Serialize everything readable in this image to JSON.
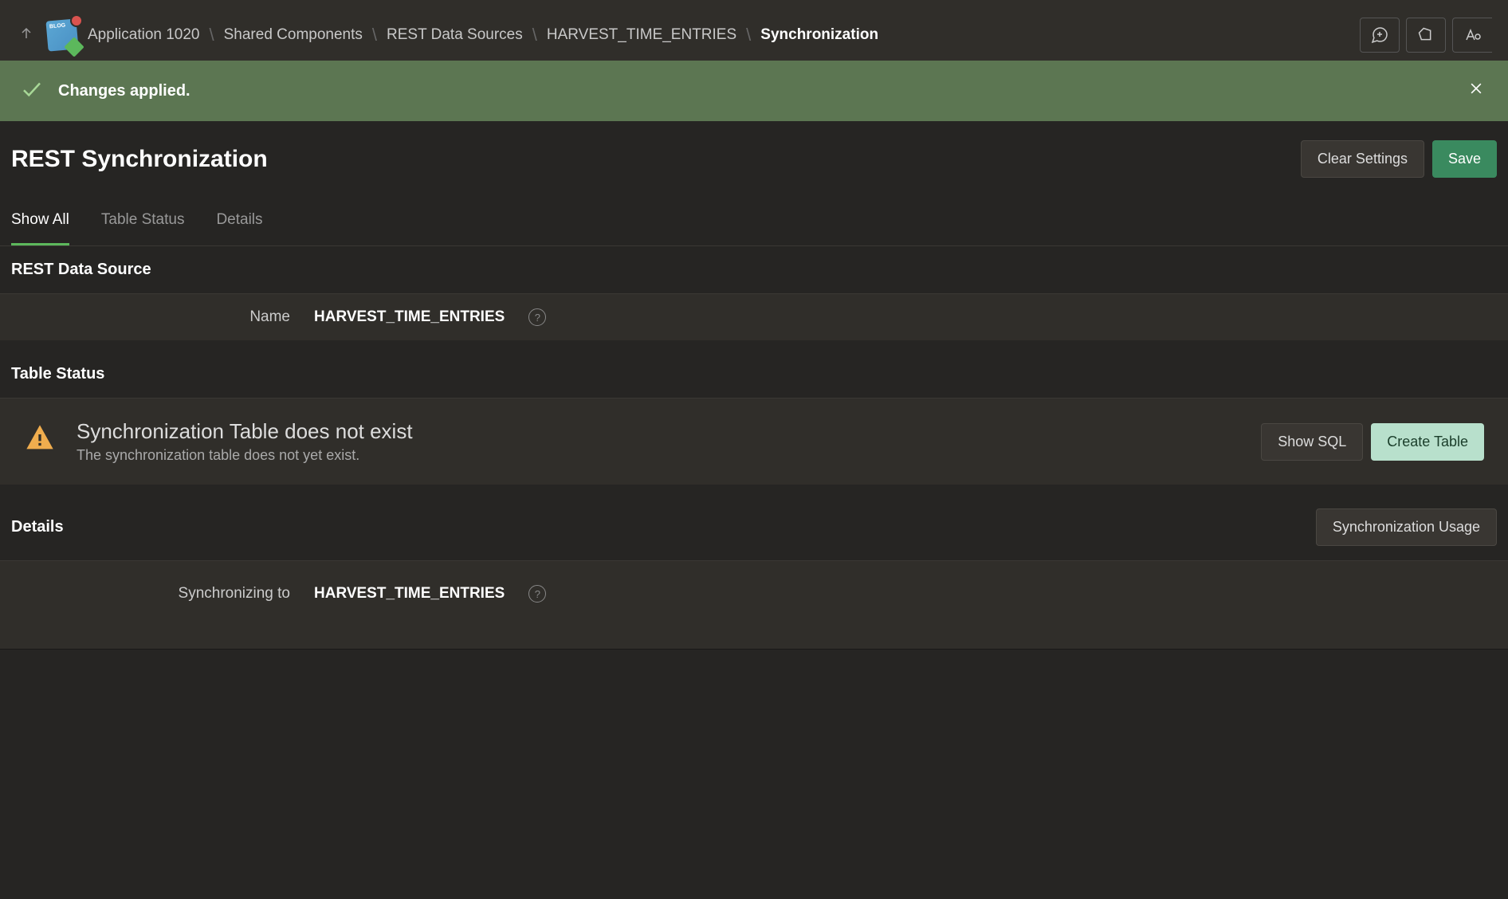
{
  "breadcrumb": {
    "app": "Application 1020",
    "shared": "Shared Components",
    "rest": "REST Data Sources",
    "entry": "HARVEST_TIME_ENTRIES",
    "current": "Synchronization"
  },
  "notification": {
    "message": "Changes applied."
  },
  "page": {
    "title": "REST Synchronization",
    "clear_settings": "Clear Settings",
    "save": "Save"
  },
  "tabs": {
    "show_all": "Show All",
    "table_status": "Table Status",
    "details": "Details"
  },
  "sections": {
    "rest_data_source": {
      "title": "REST Data Source",
      "name_label": "Name",
      "name_value": "HARVEST_TIME_ENTRIES"
    },
    "table_status": {
      "title": "Table Status",
      "warning_title": "Synchronization Table does not exist",
      "warning_subtitle": "The synchronization table does not yet exist.",
      "show_sql": "Show SQL",
      "create_table": "Create Table"
    },
    "details": {
      "title": "Details",
      "sync_usage": "Synchronization Usage",
      "sync_to_label": "Synchronizing to",
      "sync_to_value": "HARVEST_TIME_ENTRIES"
    }
  }
}
